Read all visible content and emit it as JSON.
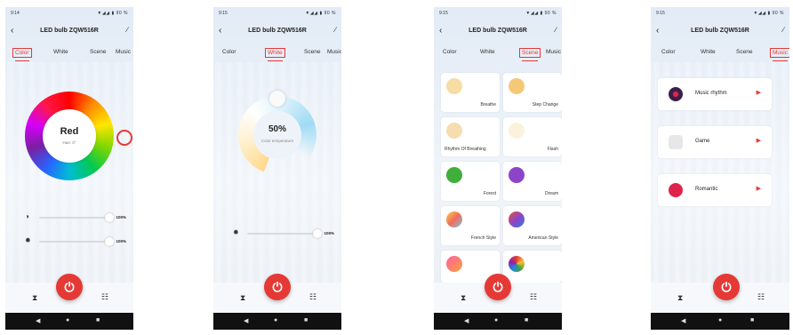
{
  "screens": [
    {
      "status_time": "9:14",
      "status_icons": "▼◢◢ ▮ 90 %",
      "title": "LED bulb ZQW516R",
      "tabs": [
        "Color",
        "White",
        "Scene",
        "Music"
      ],
      "active_tab": "Color",
      "color_name": "Red",
      "hue_text": "Hue: 0°",
      "brightness_value": "100%",
      "saturation_value": "100%"
    },
    {
      "status_time": "9:15",
      "status_icons": "▼◢◢ ▮ 90 %",
      "title": "LED bulb ZQW516R",
      "tabs": [
        "Color",
        "White",
        "Scene",
        "Music"
      ],
      "active_tab": "White",
      "temp_value": "50%",
      "temp_label": "Color temperature",
      "brightness_value": "100%"
    },
    {
      "status_time": "9:15",
      "status_icons": "▼◢◢ ▮ 90 %",
      "title": "LED bulb ZQW516R",
      "tabs": [
        "Color",
        "White",
        "Scene",
        "Music"
      ],
      "active_tab": "Scene",
      "scenes": [
        {
          "label": "Breathe",
          "color": "#f7dca3"
        },
        {
          "label": "Step Change",
          "color": "#f5c878"
        },
        {
          "label": "Rhythm Of Breathing",
          "color": "#f6ddb0"
        },
        {
          "label": "Flash",
          "color": "#fbf2dd"
        },
        {
          "label": "Forest",
          "color": "#3fae3a"
        },
        {
          "label": "Dream",
          "color": "#8e44c9"
        },
        {
          "label": "French Style",
          "color": "#f6b44a"
        },
        {
          "label": "American Style",
          "color": "#e3572f"
        }
      ]
    },
    {
      "status_time": "9:15",
      "status_icons": "▼◢◢ ▮ 90 %",
      "title": "LED bulb ZQW516R",
      "tabs": [
        "Color",
        "White",
        "Scene",
        "Music"
      ],
      "active_tab": "Music",
      "items": [
        {
          "label": "Music rhythm",
          "color": "#3a1f4a"
        },
        {
          "label": "Game",
          "color": "#e0e0e0"
        },
        {
          "label": "Romantic",
          "color": "#e0234b"
        }
      ]
    }
  ],
  "icons": {
    "back": "chevron-left-icon",
    "edit": "pencil-icon",
    "power": "power-icon",
    "timer": "hourglass-icon",
    "grid": "grid-icon",
    "brightness": "brightness-icon",
    "sun": "sun-icon",
    "play": "play-icon"
  },
  "colors": {
    "accent": "#e53935"
  }
}
